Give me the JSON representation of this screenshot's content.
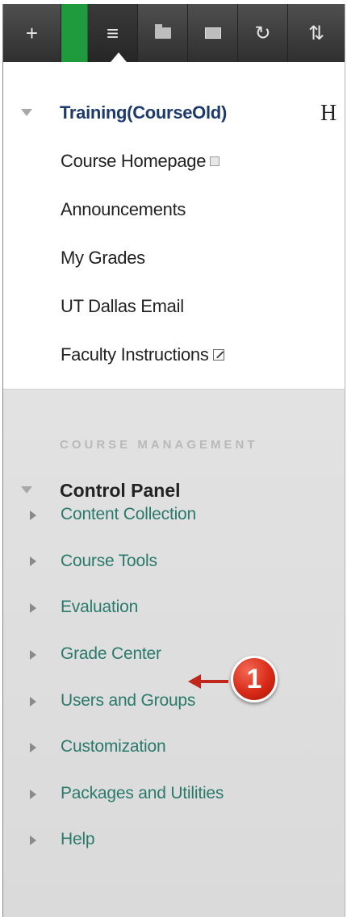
{
  "toolbar": {
    "buttons": [
      {
        "name": "add-menu-item",
        "glyph": "+"
      },
      {
        "name": "green-status",
        "glyph": ""
      },
      {
        "name": "course-menu-list",
        "glyph": "≡"
      },
      {
        "name": "folder-view",
        "glyph": "▬"
      },
      {
        "name": "display-window",
        "glyph": "▬"
      },
      {
        "name": "refresh",
        "glyph": "↻"
      },
      {
        "name": "reorder",
        "glyph": "⇅"
      }
    ]
  },
  "course_menu": {
    "title": "Training(CourseOld)",
    "heading_initial": "H",
    "items": [
      {
        "label": "Course Homepage"
      },
      {
        "label": "Announcements"
      },
      {
        "label": "My Grades"
      },
      {
        "label": "UT Dallas Email"
      },
      {
        "label": "Faculty Instructions"
      }
    ]
  },
  "control_panel": {
    "section_label": "COURSE MANAGEMENT",
    "title": "Control Panel",
    "items": [
      {
        "label": "Content Collection"
      },
      {
        "label": "Course Tools"
      },
      {
        "label": "Evaluation"
      },
      {
        "label": "Grade Center"
      },
      {
        "label": "Users and Groups"
      },
      {
        "label": "Customization"
      },
      {
        "label": "Packages and Utilities"
      },
      {
        "label": "Help"
      }
    ]
  },
  "callout": {
    "number": "1",
    "color": "#d82a17"
  },
  "colors": {
    "accent": "#1f9a3c",
    "link": "#2a7a6c",
    "course_title": "#1d3a6d"
  }
}
